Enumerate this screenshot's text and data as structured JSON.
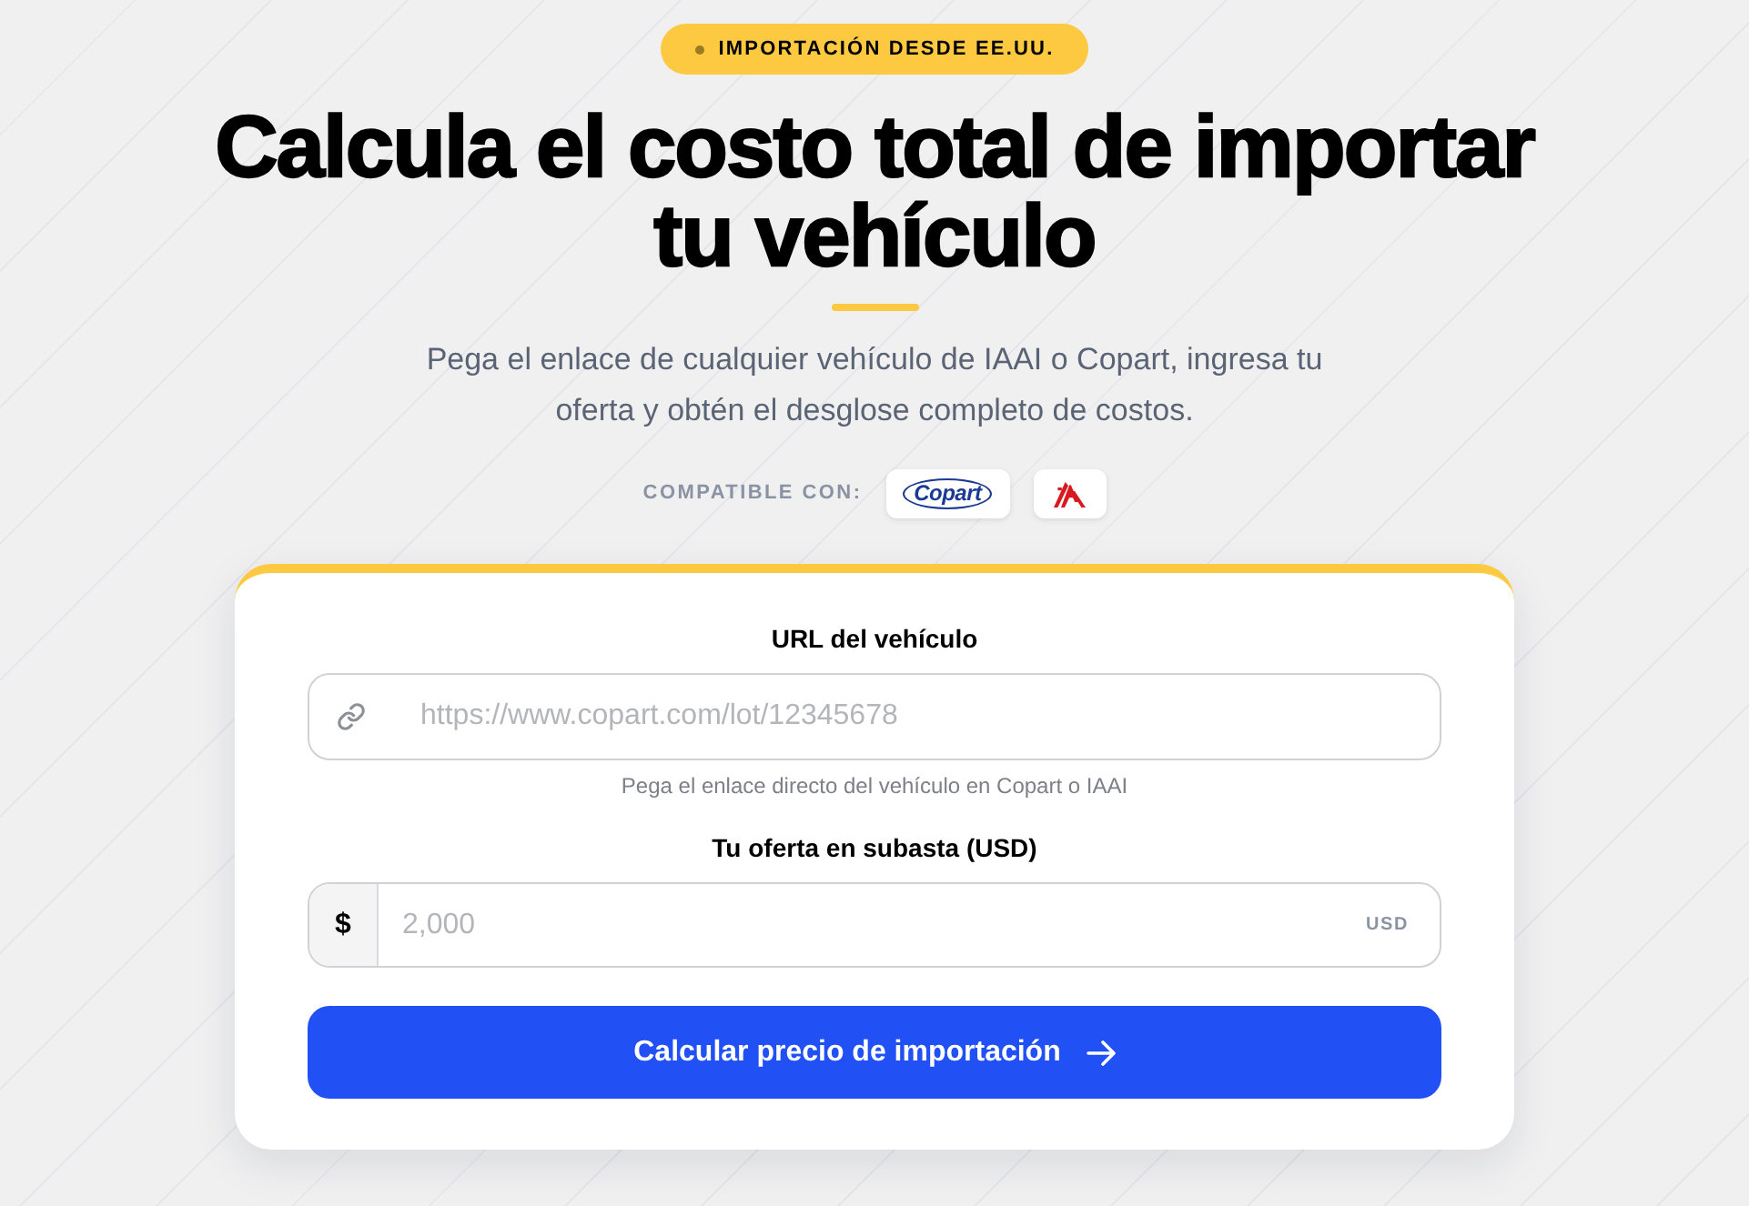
{
  "badge": {
    "text": "IMPORTACIÓN DESDE EE.UU."
  },
  "title": "Calcula el costo total de importar tu vehículo",
  "subtitle": "Pega el enlace de cualquier vehículo de IAAI o Copart, ingresa tu oferta y obtén el desglose completo de costos.",
  "compatible": {
    "label": "COMPATIBLE CON:",
    "logos": [
      {
        "kind": "copart",
        "text": "Copart"
      },
      {
        "kind": "iaa"
      }
    ]
  },
  "form": {
    "url_field": {
      "label": "URL del vehículo",
      "placeholder": "https://www.copart.com/lot/12345678",
      "hint": "Pega el enlace directo del vehículo en Copart o IAAI"
    },
    "bid_field": {
      "label": "Tu oferta en subasta (USD)",
      "prefix": "$",
      "placeholder": "2,000",
      "suffix": "USD"
    },
    "submit": {
      "label": "Calcular precio de importación"
    }
  }
}
